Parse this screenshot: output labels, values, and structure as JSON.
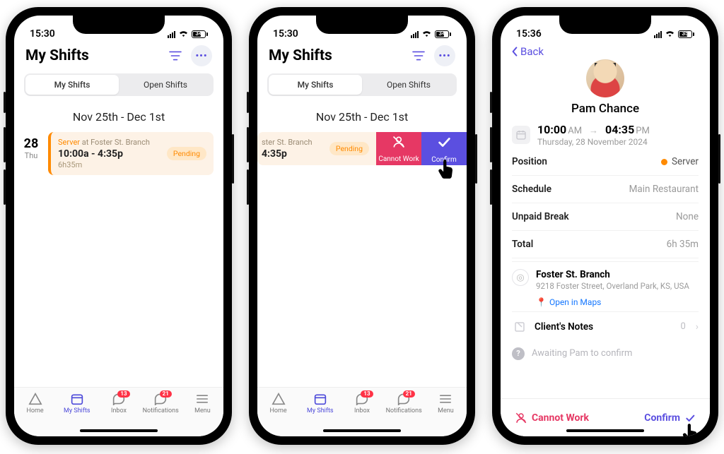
{
  "colors": {
    "accent": "#5b4fe0",
    "warn": "#ff8a00",
    "danger": "#e63864",
    "link": "#1577ff"
  },
  "status": {
    "time_a": "15:30",
    "time_c": "15:36",
    "battery": "34",
    "battery_c": "35"
  },
  "list": {
    "title": "My Shifts",
    "tabs": {
      "mine": "My Shifts",
      "open": "Open Shifts"
    },
    "date_range": "Nov 25th - Dec 1st",
    "day": {
      "num": "28",
      "name": "Thu"
    },
    "shift": {
      "role": "Server",
      "at_word": "at",
      "venue": "Foster St. Branch",
      "time": "10:00a - 4:35p",
      "duration": "6h35m",
      "status_badge": "Pending",
      "swipe": {
        "venue_short": "ster St. Branch",
        "time_short": "4:35p",
        "cannot": "Cannot Work",
        "confirm": "Confirm"
      }
    }
  },
  "tabs": {
    "home": "Home",
    "myshifts": "My Shifts",
    "inbox": "Inbox",
    "notifications": "Notifications",
    "menu": "Menu",
    "inbox_badge": "13",
    "notif_badge": "21"
  },
  "detail": {
    "back": "Back",
    "person": "Pam Chance",
    "start_num": "10:00",
    "start_ampm": "AM",
    "end_num": "04:35",
    "end_ampm": "PM",
    "date_long": "Thursday, 28 November 2024",
    "rows": {
      "position_k": "Position",
      "position_v": "Server",
      "schedule_k": "Schedule",
      "schedule_v": "Main Restaurant",
      "break_k": "Unpaid Break",
      "break_v": "None",
      "total_k": "Total",
      "total_v": "6h 35m"
    },
    "location": {
      "name": "Foster St. Branch",
      "addr": "9218 Foster Street, Overland Park, KS, USA",
      "open_maps": "Open in Maps"
    },
    "notes_label": "Client's Notes",
    "notes_count": "0",
    "awaiting": "Awaiting Pam to confirm",
    "actions": {
      "cannot": "Cannot Work",
      "confirm": "Confirm"
    }
  }
}
